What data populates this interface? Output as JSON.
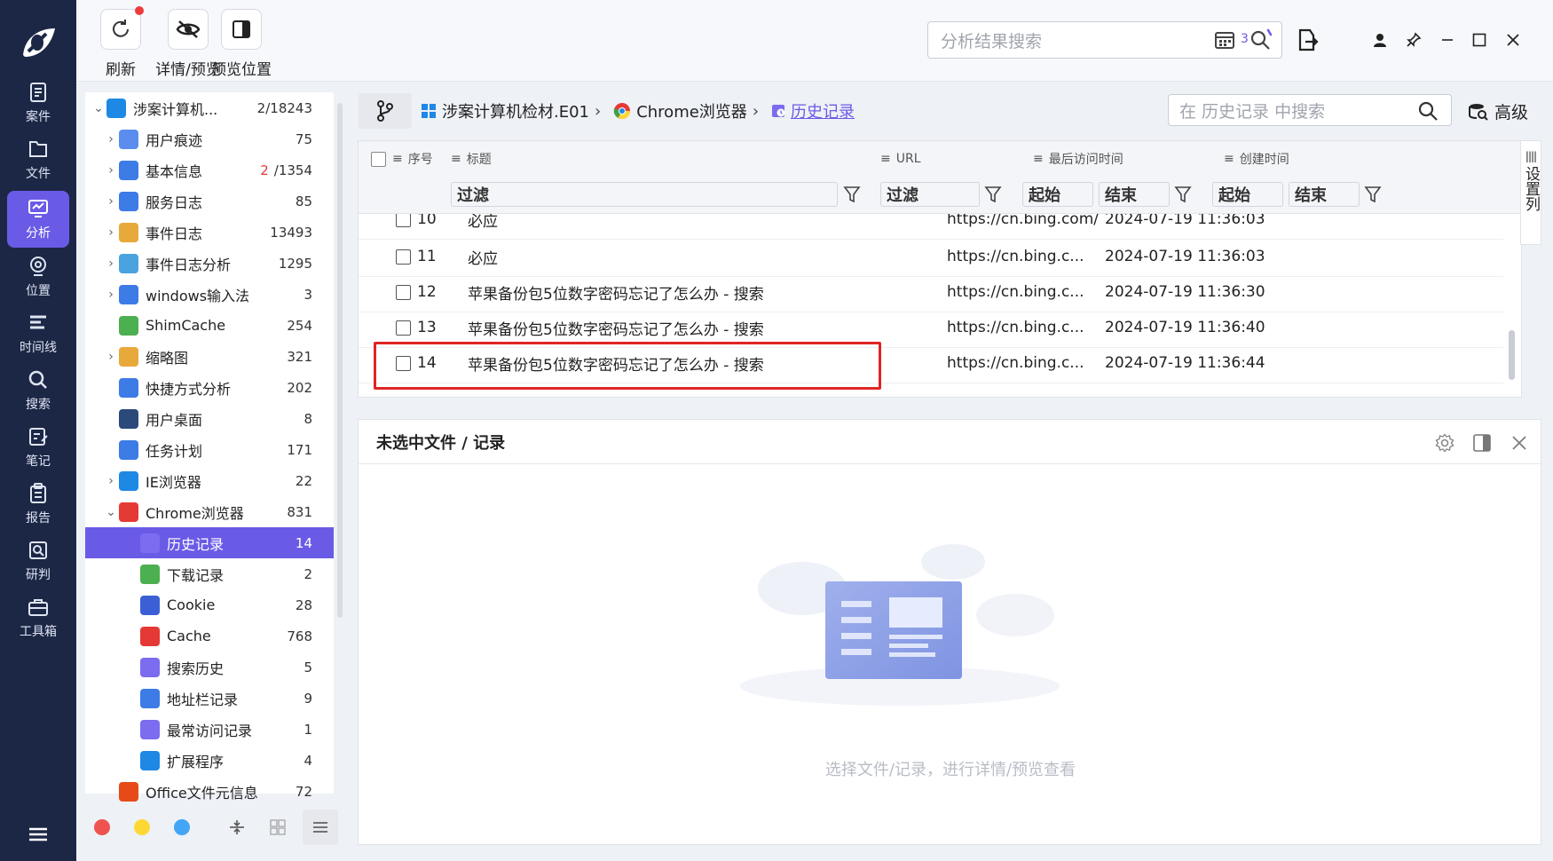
{
  "rail": {
    "items": [
      {
        "label": "案件",
        "icon": "case-icon"
      },
      {
        "label": "文件",
        "icon": "folder-icon"
      },
      {
        "label": "分析",
        "icon": "analysis-icon",
        "active": true
      },
      {
        "label": "位置",
        "icon": "location-icon"
      },
      {
        "label": "时间线",
        "icon": "timeline-icon"
      },
      {
        "label": "搜索",
        "icon": "search-icon"
      },
      {
        "label": "笔记",
        "icon": "note-icon"
      },
      {
        "label": "报告",
        "icon": "report-icon"
      },
      {
        "label": "研判",
        "icon": "judge-icon"
      },
      {
        "label": "工具箱",
        "icon": "toolbox-icon"
      }
    ]
  },
  "toolbar": {
    "refresh": "刷新",
    "detail_preview": "详情/预览",
    "preview_position": "预览位置",
    "search_placeholder": "分析结果搜索",
    "task_count": "3"
  },
  "tree": {
    "root": {
      "label": "涉案计算机...",
      "count": "2/18243"
    },
    "items": [
      {
        "label": "用户痕迹",
        "count": "75",
        "expand": true,
        "color": "#5b8def"
      },
      {
        "label": "基本信息",
        "count_red": "2",
        "count": "/1354",
        "expand": true,
        "color": "#3d7be6"
      },
      {
        "label": "服务日志",
        "count": "85",
        "expand": true,
        "color": "#3d7be6"
      },
      {
        "label": "事件日志",
        "count": "13493",
        "expand": true,
        "color": "#e8a93b"
      },
      {
        "label": "事件日志分析",
        "count": "1295",
        "expand": true,
        "color": "#4aa3df"
      },
      {
        "label": "windows输入法",
        "count": "3",
        "expand": true,
        "color": "#3d7be6"
      },
      {
        "label": "ShimCache",
        "count": "254",
        "expand": false,
        "color": "#4caf50"
      },
      {
        "label": "缩略图",
        "count": "321",
        "expand": true,
        "color": "#e8a93b"
      },
      {
        "label": "快捷方式分析",
        "count": "202",
        "expand": false,
        "color": "#3d7be6"
      },
      {
        "label": "用户桌面",
        "count": "8",
        "expand": false,
        "color": "#2b4a7a"
      },
      {
        "label": "任务计划",
        "count": "171",
        "expand": false,
        "color": "#3d7be6"
      },
      {
        "label": "IE浏览器",
        "count": "22",
        "expand": true,
        "color": "#1e88e5"
      },
      {
        "label": "Chrome浏览器",
        "count": "831",
        "expand": "open",
        "color": "#e53935"
      }
    ],
    "chrome_children": [
      {
        "label": "历史记录",
        "count": "14",
        "selected": true,
        "color": "#7b6cf0"
      },
      {
        "label": "下载记录",
        "count": "2",
        "color": "#4caf50"
      },
      {
        "label": "Cookie",
        "count": "28",
        "color": "#3d5fd6"
      },
      {
        "label": "Cache",
        "count": "768",
        "color": "#e53935"
      },
      {
        "label": "搜索历史",
        "count": "5",
        "color": "#7b6cf0"
      },
      {
        "label": "地址栏记录",
        "count": "9",
        "color": "#3d7be6"
      },
      {
        "label": "最常访问记录",
        "count": "1",
        "color": "#7b6cf0"
      },
      {
        "label": "扩展程序",
        "count": "4",
        "color": "#1e88e5"
      }
    ],
    "tail": {
      "label": "Office文件元信息",
      "count": "72",
      "color": "#e64a19"
    }
  },
  "breadcrumb": {
    "items": [
      "涉案计算机检材.E01",
      "Chrome浏览器",
      "历史记录"
    ],
    "search_placeholder": "在 历史记录 中搜索",
    "advanced": "高级"
  },
  "table": {
    "headers": [
      "序号",
      "标题",
      "URL",
      "最后访问时间",
      "创建时间"
    ],
    "filter_label": "过滤",
    "start_label": "起始",
    "end_label": "结束",
    "set_columns": "设置列",
    "partial_row": {
      "no": "10",
      "title": "必应",
      "url": "https://cn.bing.com/",
      "time": "2024-07-19 11:36:03"
    },
    "rows": [
      {
        "no": "11",
        "title": "必应",
        "url": "https://cn.bing.c...",
        "time": "2024-07-19 11:36:03"
      },
      {
        "no": "12",
        "title": "苹果备份包5位数字密码忘记了怎么办 - 搜索",
        "url": "https://cn.bing.c...",
        "time": "2024-07-19 11:36:30"
      },
      {
        "no": "13",
        "title": "苹果备份包5位数字密码忘记了怎么办 - 搜索",
        "url": "https://cn.bing.c...",
        "time": "2024-07-19 11:36:40"
      },
      {
        "no": "14",
        "title": "苹果备份包5位数字密码忘记了怎么办 - 搜索",
        "url": "https://cn.bing.c...",
        "time": "2024-07-19 11:36:44"
      }
    ]
  },
  "detail": {
    "title": "未选中文件 / 记录",
    "empty_hint": "选择文件/记录，进行详情/预览查看"
  },
  "colors": {
    "accent": "#6a5be6",
    "rail": "#1c2746",
    "highlight": "#e02424"
  }
}
